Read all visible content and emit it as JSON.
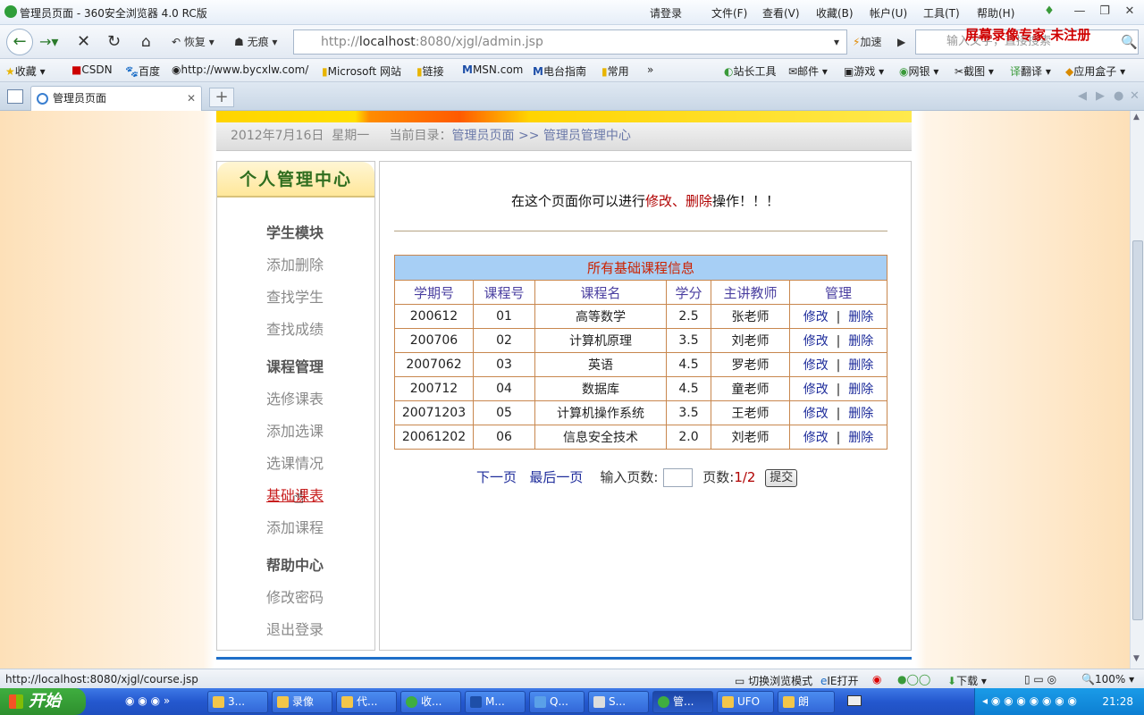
{
  "window": {
    "title": "管理员页面 - 360安全浏览器 4.0 RC版",
    "menus": [
      "请登录",
      "文件(F)",
      "查看(V)",
      "收藏(B)",
      "帐户(U)",
      "工具(T)",
      "帮助(H)"
    ],
    "watermark": "屏幕录像专家 未注册"
  },
  "nav": {
    "restore_label": "恢复",
    "incognito_label": "无痕",
    "address_prefix": "http://",
    "address_host": "localhost",
    "address_rest": ":8080/xjgl/admin.jsp",
    "accelerate_label": "加速",
    "search_placeholder": "输入文字，直接搜索"
  },
  "favorites": {
    "items": [
      "收藏",
      "CSDN",
      "百度",
      "http://www.bycxlw.com/",
      "Microsoft 网站",
      "链接",
      "MSN.com",
      "电台指南",
      "常用"
    ],
    "more": "»",
    "right_items": [
      "站长工具",
      "邮件",
      "游戏",
      "网银",
      "截图",
      "翻译",
      "应用盒子"
    ]
  },
  "tabs": [
    {
      "label": "管理员页面"
    }
  ],
  "page": {
    "breadcrumb": {
      "date": "2012年7月16日",
      "weekday": "星期一",
      "current_label": "当前目录：",
      "path1": "管理员页面",
      "sep": ">>",
      "path2": "管理员管理中心"
    },
    "sidebar": {
      "title": "个人管理中心",
      "sections": [
        {
          "title": "学生模块",
          "items": [
            "添加删除",
            "查找学生",
            "查找成绩"
          ]
        },
        {
          "title": "课程管理",
          "items": [
            "选修课表",
            "添加选课",
            "选课情况",
            "基础课表",
            "添加课程"
          ]
        },
        {
          "title": "帮助中心",
          "items": [
            "修改密码",
            "退出登录"
          ]
        }
      ],
      "active_item": "基础课表"
    },
    "message": {
      "prefix": "在这个页面你可以进行",
      "highlight": "修改、删除",
      "suffix": "操作！！！"
    },
    "table": {
      "caption": "所有基础课程信息",
      "headers": [
        "学期号",
        "课程号",
        "课程名",
        "学分",
        "主讲教师",
        "管理"
      ],
      "rows": [
        [
          "200612",
          "01",
          "高等数学",
          "2.5",
          "张老师"
        ],
        [
          "200706",
          "02",
          "计算机原理",
          "3.5",
          "刘老师"
        ],
        [
          "2007062",
          "03",
          "英语",
          "4.5",
          "罗老师"
        ],
        [
          "200712",
          "04",
          "数据库",
          "4.5",
          "童老师"
        ],
        [
          "20071203",
          "05",
          "计算机操作系统",
          "3.5",
          "王老师"
        ],
        [
          "20061202",
          "06",
          "信息安全技术",
          "2.0",
          "刘老师"
        ]
      ],
      "edit_label": "修改",
      "sep": "|",
      "delete_label": "删除"
    },
    "pager": {
      "next": "下一页",
      "last": "最后一页",
      "input_label": "输入页数:",
      "pages_label": "页数:",
      "pages_value": "1/2",
      "submit": "提交"
    }
  },
  "status": {
    "url": "http://localhost:8080/xjgl/course.jsp",
    "switch_mode": "切换浏览模式",
    "ie_open": "IE打开",
    "download": "下载",
    "zoom": "100%"
  },
  "taskbar": {
    "start": "开始",
    "tasks": [
      "3...",
      "录像",
      "代...",
      "收...",
      "M...",
      "Q...",
      "S...",
      "管...",
      "UFO",
      "朗"
    ],
    "clock": "21:28"
  }
}
